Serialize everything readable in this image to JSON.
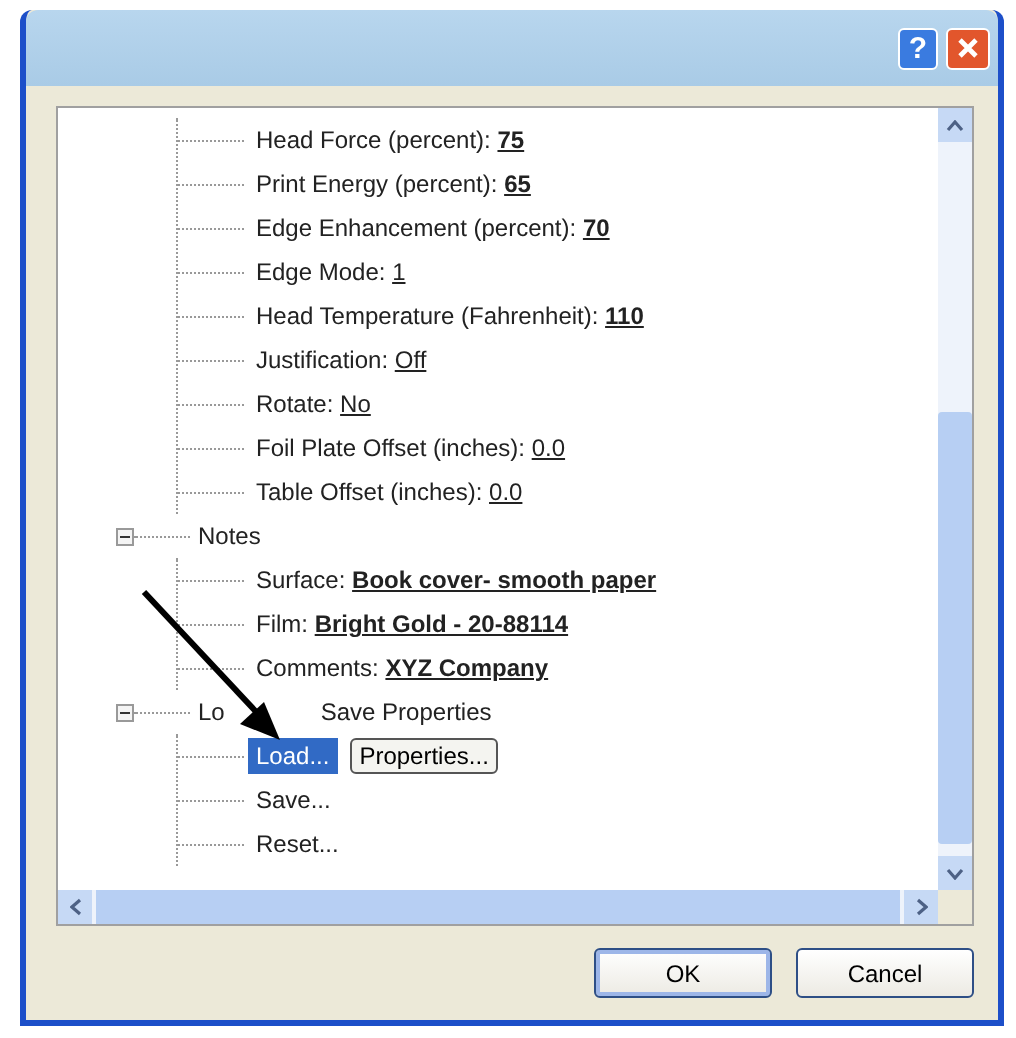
{
  "window": {
    "help_button": "?"
  },
  "tree": {
    "continued_children": [
      {
        "label": "Head Force (percent):",
        "value": "75",
        "bold": true
      },
      {
        "label": "Print Energy (percent):",
        "value": "65",
        "bold": true
      },
      {
        "label": "Edge Enhancement (percent):",
        "value": "70",
        "bold": true
      },
      {
        "label": "Edge Mode:",
        "value": "1",
        "bold": false
      },
      {
        "label": "Head Temperature (Fahrenheit):",
        "value": "110",
        "bold": true
      },
      {
        "label": "Justification:",
        "value": "Off",
        "bold": false
      },
      {
        "label": "Rotate:",
        "value": "No",
        "bold": false
      },
      {
        "label": "Foil Plate Offset (inches):",
        "value": "0.0",
        "bold": false
      },
      {
        "label": "Table Offset (inches):",
        "value": "0.0",
        "bold": false
      }
    ],
    "groups": [
      {
        "label_parts": [
          "Notes"
        ],
        "expanded": true,
        "children": [
          {
            "kind": "field",
            "label": "Surface:",
            "value": "Book cover- smooth paper",
            "bold": true
          },
          {
            "kind": "field",
            "label": "Film:",
            "value": "Bright Gold - 20-88114",
            "bold": true
          },
          {
            "kind": "field",
            "label": "Comments:",
            "value": "XYZ Company",
            "bold": true
          }
        ]
      },
      {
        "label_parts": [
          "Lo",
          "Save Properties"
        ],
        "expanded": true,
        "children": [
          {
            "kind": "action",
            "label": "Load...",
            "selected": true,
            "button": "Properties..."
          },
          {
            "kind": "action",
            "label": "Save...",
            "selected": false
          },
          {
            "kind": "action",
            "label": "Reset...",
            "selected": false
          }
        ]
      }
    ]
  },
  "buttons": [
    "OK",
    "Cancel"
  ]
}
